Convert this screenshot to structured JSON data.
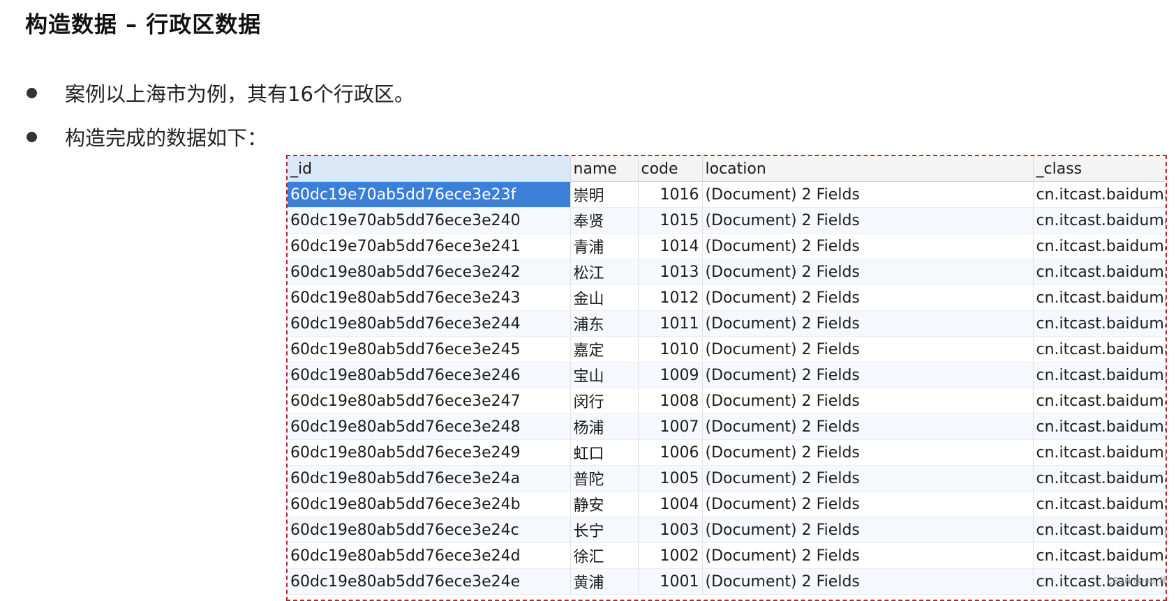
{
  "title": "构造数据 – 行政区数据",
  "bullets": [
    "案例以上海市为例，其有16个行政区。",
    "构造完成的数据如下："
  ],
  "table": {
    "columns": [
      "_id",
      "name",
      "code",
      "location",
      "_class"
    ],
    "rows": [
      {
        "id": "60dc19e70ab5dd76ece3e23f",
        "name": "崇明",
        "code": "1016",
        "location": "(Document) 2 Fields",
        "class": "cn.itcast.baiduma"
      },
      {
        "id": "60dc19e70ab5dd76ece3e240",
        "name": "奉贤",
        "code": "1015",
        "location": "(Document) 2 Fields",
        "class": "cn.itcast.baiduma"
      },
      {
        "id": "60dc19e70ab5dd76ece3e241",
        "name": "青浦",
        "code": "1014",
        "location": "(Document) 2 Fields",
        "class": "cn.itcast.baiduma"
      },
      {
        "id": "60dc19e80ab5dd76ece3e242",
        "name": "松江",
        "code": "1013",
        "location": "(Document) 2 Fields",
        "class": "cn.itcast.baiduma"
      },
      {
        "id": "60dc19e80ab5dd76ece3e243",
        "name": "金山",
        "code": "1012",
        "location": "(Document) 2 Fields",
        "class": "cn.itcast.baiduma"
      },
      {
        "id": "60dc19e80ab5dd76ece3e244",
        "name": "浦东",
        "code": "1011",
        "location": "(Document) 2 Fields",
        "class": "cn.itcast.baiduma"
      },
      {
        "id": "60dc19e80ab5dd76ece3e245",
        "name": "嘉定",
        "code": "1010",
        "location": "(Document) 2 Fields",
        "class": "cn.itcast.baiduma"
      },
      {
        "id": "60dc19e80ab5dd76ece3e246",
        "name": "宝山",
        "code": "1009",
        "location": "(Document) 2 Fields",
        "class": "cn.itcast.baiduma"
      },
      {
        "id": "60dc19e80ab5dd76ece3e247",
        "name": "闵行",
        "code": "1008",
        "location": "(Document) 2 Fields",
        "class": "cn.itcast.baiduma"
      },
      {
        "id": "60dc19e80ab5dd76ece3e248",
        "name": "杨浦",
        "code": "1007",
        "location": "(Document) 2 Fields",
        "class": "cn.itcast.baiduma"
      },
      {
        "id": "60dc19e80ab5dd76ece3e249",
        "name": "虹口",
        "code": "1006",
        "location": "(Document) 2 Fields",
        "class": "cn.itcast.baiduma"
      },
      {
        "id": "60dc19e80ab5dd76ece3e24a",
        "name": "普陀",
        "code": "1005",
        "location": "(Document) 2 Fields",
        "class": "cn.itcast.baiduma"
      },
      {
        "id": "60dc19e80ab5dd76ece3e24b",
        "name": "静安",
        "code": "1004",
        "location": "(Document) 2 Fields",
        "class": "cn.itcast.baiduma"
      },
      {
        "id": "60dc19e80ab5dd76ece3e24c",
        "name": "长宁",
        "code": "1003",
        "location": "(Document) 2 Fields",
        "class": "cn.itcast.baiduma"
      },
      {
        "id": "60dc19e80ab5dd76ece3e24d",
        "name": "徐汇",
        "code": "1002",
        "location": "(Document) 2 Fields",
        "class": "cn.itcast.baiduma"
      },
      {
        "id": "60dc19e80ab5dd76ece3e24e",
        "name": "黄浦",
        "code": "1001",
        "location": "(Document) 2 Fields",
        "class": "cn.itcast.baiduma"
      }
    ]
  },
  "watermark": "CSDN @mo_移"
}
